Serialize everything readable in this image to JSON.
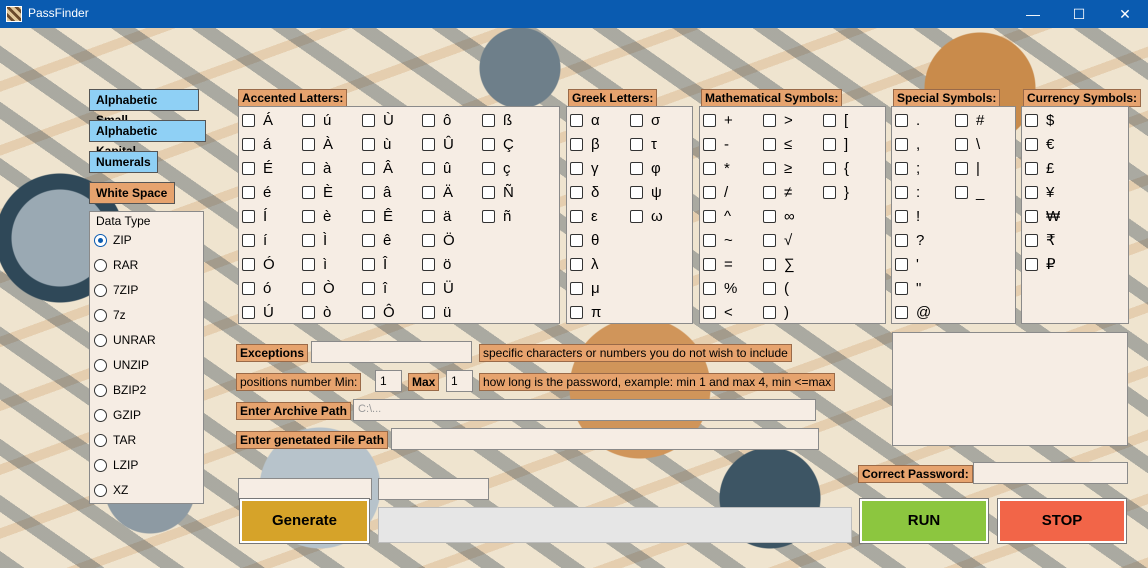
{
  "window": {
    "title": "PassFinder",
    "minimize": "—",
    "maximize": "☐",
    "close": "✕"
  },
  "charset_buttons": [
    "Alphabetic Small",
    "Alphabetic Kapital",
    "Numerals",
    "White Space"
  ],
  "data_type": {
    "label": "Data Type",
    "options": [
      "ZIP",
      "RAR",
      "7ZIP",
      "7z",
      "UNRAR",
      "UNZIP",
      "BZIP2",
      "GZIP",
      "TAR",
      "LZIP",
      "XZ"
    ],
    "selected": "ZIP"
  },
  "groups": {
    "accented": {
      "label": "Accented Latters:",
      "items": [
        "Á",
        "á",
        "É",
        "é",
        "Í",
        "í",
        "Ó",
        "ó",
        "Ú",
        "ú",
        "À",
        "à",
        "È",
        "è",
        "Ì",
        "ì",
        "Ò",
        "ò",
        "Ù",
        "ù",
        "Â",
        "â",
        "Ê",
        "ê",
        "Î",
        "î",
        "Ô",
        "ô",
        "Û",
        "û",
        "Ä",
        "ä",
        "Ö",
        "ö",
        "Ü",
        "ü",
        "ß",
        "Ç",
        "ç",
        "Ñ",
        "ñ"
      ]
    },
    "greek": {
      "label": "Greek Letters:",
      "items": [
        "α",
        "β",
        "γ",
        "δ",
        "ε",
        "θ",
        "λ",
        "μ",
        "π",
        "σ",
        "τ",
        "φ",
        "ψ",
        "ω"
      ]
    },
    "math": {
      "label": "Mathematical Symbols:",
      "items": [
        "+",
        "-",
        "*",
        "/",
        "^",
        "~",
        "=",
        "%",
        "<",
        ">",
        "≤",
        "≥",
        "≠",
        "∞",
        "√",
        "∑",
        "(",
        ")",
        "[",
        "]",
        "{",
        "}"
      ]
    },
    "special": {
      "label": "Special Symbols:",
      "items": [
        ".",
        ",",
        ";",
        ":",
        "!",
        "?",
        "'",
        "\"",
        "@",
        "#",
        "\\",
        "|",
        "_"
      ]
    },
    "currency": {
      "label": "Currency Symbols:",
      "items": [
        "$",
        "€",
        "£",
        "¥",
        "₩",
        "₹",
        "₽"
      ]
    }
  },
  "form": {
    "exceptions_label": "Exceptions",
    "exceptions_hint": "specific characters or numbers you do not wish to include",
    "positions_label": "positions number Min:",
    "min_value": "1",
    "max_label": "Max",
    "max_value": "1",
    "positions_hint": "how long is the password, example: min 1 and max 4, min <=max",
    "archive_label": "Enter Archive Path",
    "archive_placeholder": "C:\\...",
    "generated_label": "Enter genetated File Path",
    "correct_label": "Correct Password:"
  },
  "buttons": {
    "generate": "Generate",
    "run": "RUN",
    "stop": "STOP"
  },
  "colors": {
    "titlebar": "#0a5bb0",
    "label_bg": "#e6a36e",
    "chip_blue": "#8fd0f5",
    "generate": "#d6a329",
    "run": "#8cc63f",
    "stop": "#f26548",
    "panel_bg": "#f6ede4"
  }
}
